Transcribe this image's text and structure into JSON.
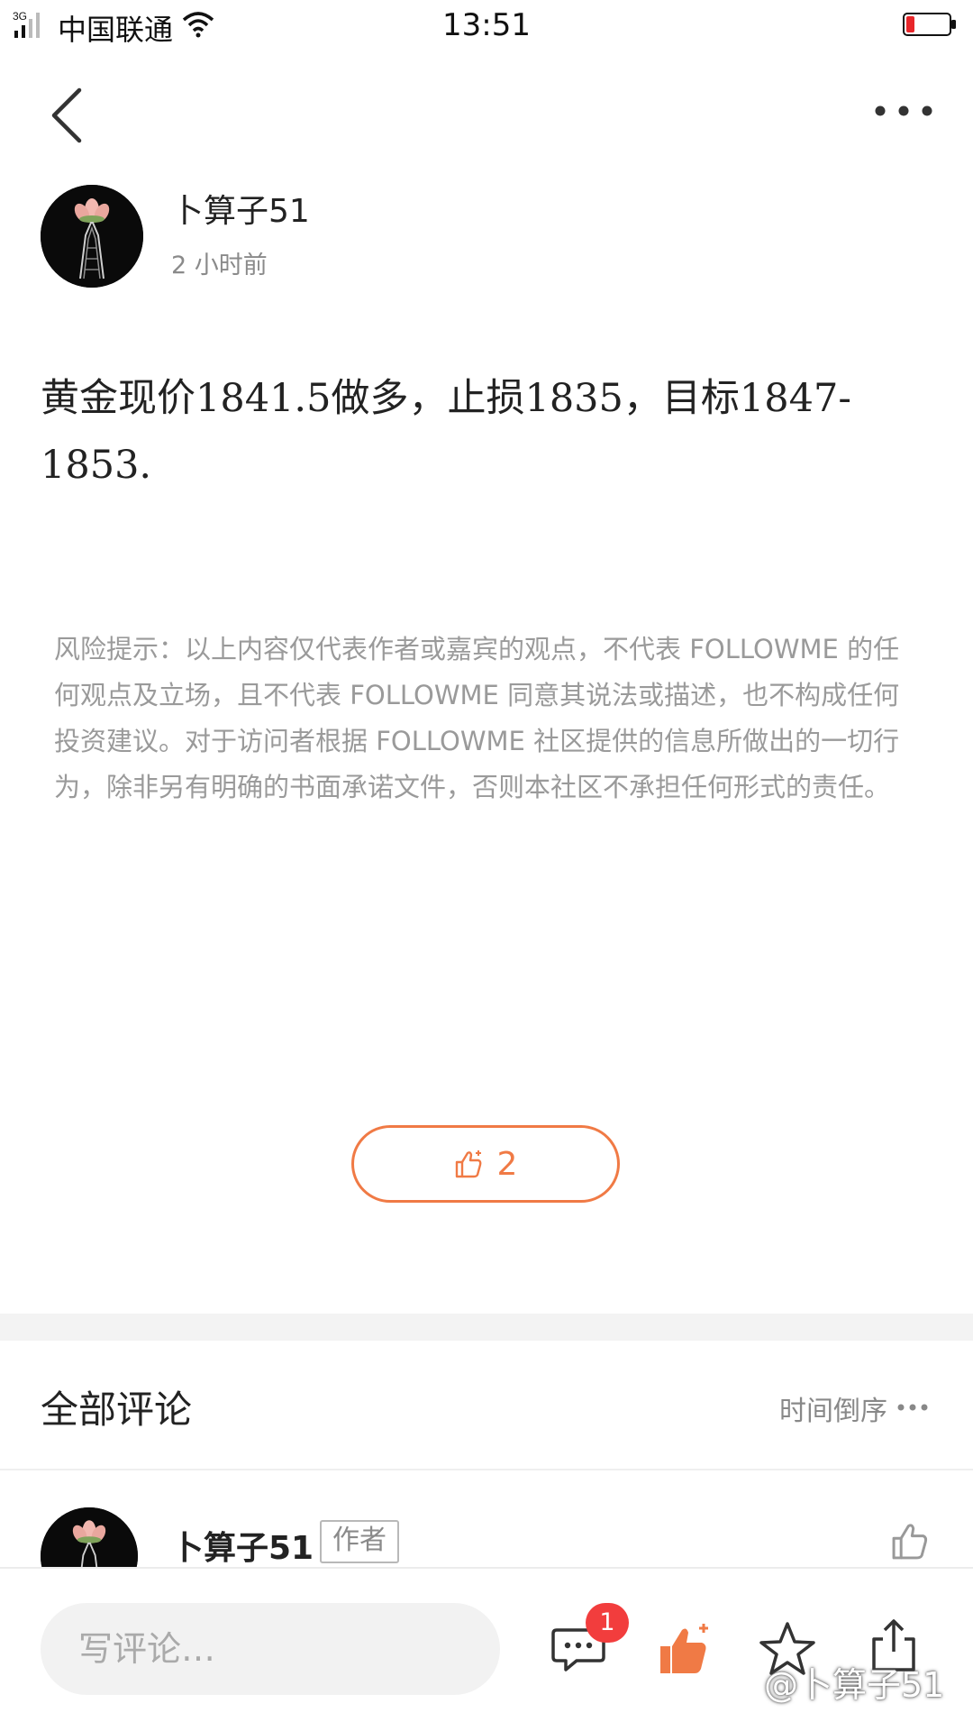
{
  "status_bar": {
    "network": "3G",
    "carrier": "中国联通",
    "time": "13:51",
    "battery_color": "#e8262a"
  },
  "nav": {
    "back_icon": "chevron-left-icon",
    "more_icon": "more-horizontal-icon"
  },
  "post": {
    "author": "卜算子51",
    "time_ago": "2 小时前",
    "body": "黄金现价1841.5做多，止损1835，目标1847-1853.",
    "disclaimer": "风险提示：以上内容仅代表作者或嘉宾的观点，不代表 FOLLOWME 的任何观点及立场，且不代表 FOLLOWME 同意其说法或描述，也不构成任何投资建议。对于访问者根据 FOLLOWME 社区提供的信息所做出的一切行为，除非另有明确的书面承诺文件，否则本社区不承担任何形式的责任。",
    "like_count": "2"
  },
  "comments": {
    "title": "全部评论",
    "sort_label": "时间倒序",
    "items": [
      {
        "author": "卜算子51",
        "badge": "作者"
      }
    ]
  },
  "bottom_bar": {
    "input_placeholder": "写评论…",
    "comment_badge": "1",
    "watermark": "@卜算子51"
  },
  "colors": {
    "accent": "#f07a45",
    "badge_red": "#f23d3d",
    "text_primary": "#222222",
    "text_secondary": "#8a8a8a"
  }
}
